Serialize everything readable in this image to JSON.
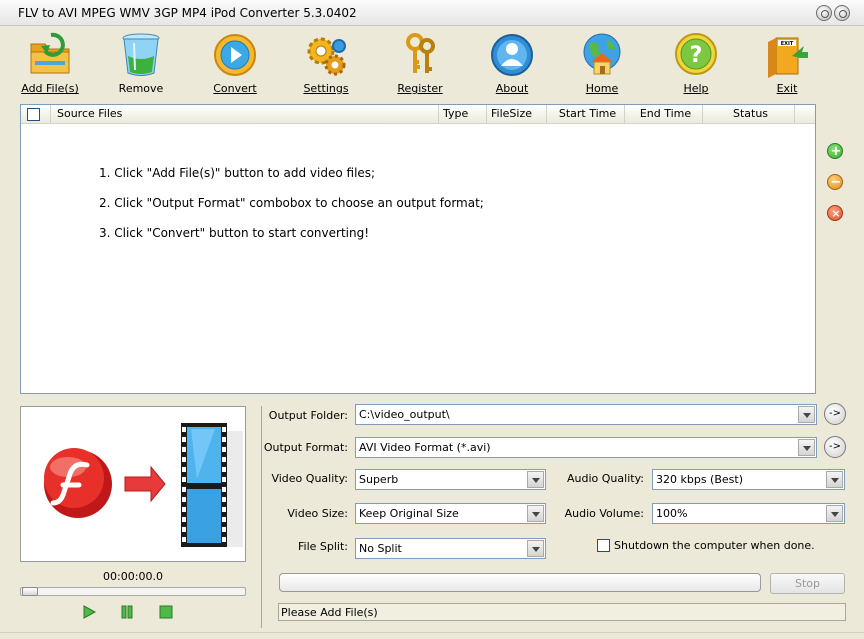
{
  "window": {
    "title": "FLV to AVI MPEG WMV 3GP MP4 iPod Converter 5.3.0402"
  },
  "toolbar": {
    "add_files": "Add File(s)",
    "remove": "Remove",
    "convert": "Convert",
    "settings": "Settings",
    "register": "Register",
    "about": "About",
    "home": "Home",
    "help": "Help",
    "exit": "Exit"
  },
  "file_list": {
    "columns": [
      "Source Files",
      "Type",
      "FileSize",
      "Start Time",
      "End Time",
      "Status"
    ],
    "instructions": [
      "1. Click \"Add File(s)\" button to add video files;",
      "2. Click \"Output Format\" combobox to choose an output format;",
      "3. Click \"Convert\" button to start converting!"
    ]
  },
  "preview": {
    "time": "00:00:00.0"
  },
  "form": {
    "output_folder_label": "Output Folder:",
    "output_folder": "C:\\video_output\\",
    "output_format_label": "Output Format:",
    "output_format": "AVI Video Format (*.avi)",
    "video_quality_label": "Video Quality:",
    "video_quality": "Superb",
    "audio_quality_label": "Audio Quality:",
    "audio_quality": "320 kbps (Best)",
    "video_size_label": "Video Size:",
    "video_size": "Keep Original Size",
    "audio_volume_label": "Audio Volume:",
    "audio_volume": "100%",
    "file_split_label": "File Split:",
    "file_split": "No Split",
    "shutdown_label": "Shutdown the computer when done.",
    "go_symbol": "->"
  },
  "controls": {
    "stop": "Stop",
    "progress": 0
  },
  "status": {
    "text": "Please Add File(s)"
  },
  "colors": {
    "window_bg": "#ece9d8",
    "list_border": "#7f9db9",
    "add_green": "#3aaa35",
    "remove_orange": "#e08a1e",
    "clear_red": "#d9532c"
  }
}
